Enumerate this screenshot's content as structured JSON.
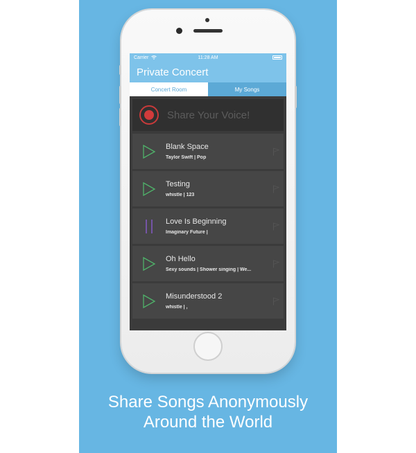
{
  "status_bar": {
    "carrier": "Carrier",
    "time": "11:28 AM"
  },
  "nav": {
    "title": "Private Concert"
  },
  "tabs": [
    {
      "label": "Concert Room",
      "selected": false
    },
    {
      "label": "My Songs",
      "selected": true
    }
  ],
  "record": {
    "label": "Share Your Voice!"
  },
  "songs": [
    {
      "title": "Blank Space",
      "meta": "Taylor Swift   |  Pop",
      "state": "play"
    },
    {
      "title": "Testing",
      "meta": "whistle  |  123",
      "state": "play"
    },
    {
      "title": "Love Is Beginning",
      "meta": "Imaginary Future   |",
      "state": "pause"
    },
    {
      "title": "Oh Hello",
      "meta": "Sexy sounds  |  Shower singing  |  We...",
      "state": "play"
    },
    {
      "title": "Misunderstood 2",
      "meta": "whistle  |  ,",
      "state": "play"
    }
  ],
  "caption": {
    "line1": "Share Songs Anonymously",
    "line2": "Around the World"
  },
  "colors": {
    "background": "#67b6e3",
    "nav": "#7ec3ea",
    "tab_active": "#5ca9d6",
    "play": "#4fb36a",
    "pause": "#8a5ad0",
    "record": "#d23b3b"
  },
  "icons": {
    "play": "play-icon",
    "pause": "pause-icon",
    "flag": "flag-icon",
    "record": "record-icon",
    "wifi": "wifi-icon",
    "battery": "battery-icon"
  }
}
